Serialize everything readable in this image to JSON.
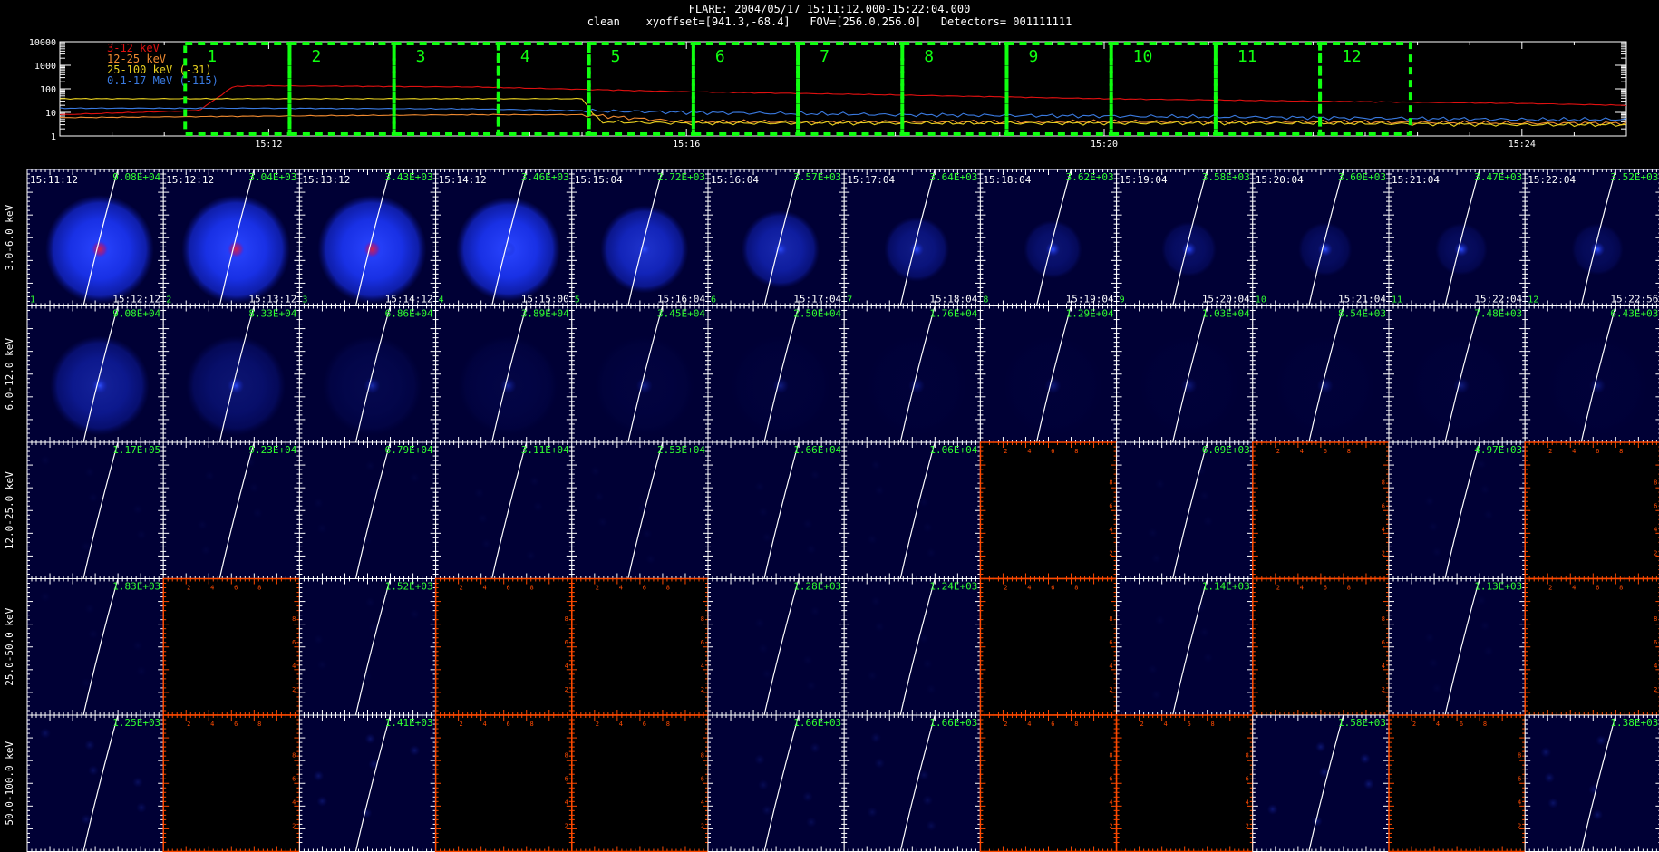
{
  "header": {
    "line1": "FLARE: 2004/05/17 15:11:12.000-15:22:04.000",
    "line2": "clean    xyoffset=[941.3,-68.4]   FOV=[256.0,256.0]   Detectors= 001111111"
  },
  "chart_data": [
    {
      "type": "line",
      "y_scale": "log",
      "ylim": [
        1,
        10000
      ],
      "y_ticks": [
        "10000",
        "1000",
        "100",
        "10",
        "1"
      ],
      "x_ticks": [
        "15:12",
        "15:16",
        "15:20",
        "15:24"
      ],
      "time_range": [
        "15:10",
        "15:25"
      ],
      "series": [
        {
          "name": "3-12 keV",
          "color": "#e01010",
          "times": [
            "15:10",
            "15:11:20",
            "15:11:40",
            "15:12",
            "15:14",
            "15:16",
            "15:18",
            "15:20",
            "15:22",
            "15:24",
            "15:25"
          ],
          "values": [
            8,
            12,
            130,
            135,
            120,
            75,
            55,
            38,
            30,
            24,
            20
          ]
        },
        {
          "name": "12-25 keV",
          "color": "#f08a30",
          "times": [
            "15:10",
            "15:12",
            "15:14",
            "15:15",
            "15:16",
            "15:18",
            "15:20",
            "15:22",
            "15:24",
            "15:25"
          ],
          "values": [
            6,
            7,
            8,
            8,
            4,
            4,
            4,
            4,
            3.5,
            3.5
          ]
        },
        {
          "name": "25-100 keV (-31)",
          "color": "#e8d020",
          "times": [
            "15:10",
            "15:12",
            "15:14",
            "15:15",
            "15:15:10",
            "15:16",
            "15:18",
            "15:20",
            "15:22",
            "15:24",
            "15:25"
          ],
          "values": [
            38,
            38,
            38,
            38,
            4,
            3.5,
            3.5,
            3.5,
            3.5,
            3,
            3
          ]
        },
        {
          "name": "0.1-17 MeV (-115)",
          "color": "#3a7ae0",
          "times": [
            "15:10",
            "15:12",
            "15:14",
            "15:16",
            "15:18",
            "15:20",
            "15:22",
            "15:24",
            "15:25"
          ],
          "values": [
            15,
            15,
            14,
            10,
            8,
            7,
            6,
            5,
            5
          ]
        }
      ],
      "annotations": [
        "1",
        "2",
        "3",
        "4",
        "5",
        "6",
        "7",
        "8",
        "9",
        "10",
        "11",
        "12"
      ],
      "interval_starts": [
        "15:11:12",
        "15:12:12",
        "15:13:12",
        "15:14:12",
        "15:15:04",
        "15:16:04",
        "15:17:04",
        "15:18:04",
        "15:19:04",
        "15:20:04",
        "15:21:04",
        "15:22:04"
      ],
      "interval_end": "15:22:56"
    },
    {
      "type": "heatmap",
      "rows": [
        "3.0-6.0 keV",
        "6.0-12.0 keV",
        "12.0-25.0 keV",
        "25.0-50.0 keV",
        "50.0-100.0 keV"
      ],
      "start_times": [
        "15:11:12",
        "15:12:12",
        "15:13:12",
        "15:14:12",
        "15:15:04",
        "15:16:04",
        "15:17:04",
        "15:18:04",
        "15:19:04",
        "15:20:04",
        "15:21:04",
        "15:22:04"
      ],
      "end_times": [
        "15:12:12",
        "15:13:12",
        "15:14:12",
        "15:15:00",
        "15:16:04",
        "15:17:04",
        "15:18:04",
        "15:19:04",
        "15:20:04",
        "15:21:04",
        "15:22:04",
        "15:22:56"
      ],
      "indices": [
        "1",
        "2",
        "3",
        "4",
        "5",
        "6",
        "7",
        "8",
        "9",
        "10",
        "11",
        "12"
      ],
      "axis_ticks": [
        "2",
        "4",
        "6",
        "8"
      ],
      "maxima": [
        [
          "9.08E+04",
          "3.04E+03",
          "3.43E+03",
          "3.46E+03",
          "2.72E+03",
          "3.57E+03",
          "3.64E+03",
          "3.62E+03",
          "3.58E+03",
          "3.60E+03",
          "3.47E+03",
          "3.52E+03"
        ],
        [
          "9.08E+04",
          "8.33E+04",
          "6.86E+04",
          "3.89E+04",
          "3.45E+04",
          "2.50E+04",
          "1.76E+04",
          "1.29E+04",
          "1.03E+04",
          "8.54E+03",
          "7.48E+03",
          "6.43E+03"
        ],
        [
          "1.17E+05",
          "9.23E+04",
          "6.79E+04",
          "3.11E+04",
          "2.53E+04",
          "1.66E+04",
          "1.06E+04",
          "",
          "6.09E+03",
          "",
          "4.97E+03",
          ""
        ],
        [
          "1.83E+03",
          "",
          "1.52E+03",
          "",
          "",
          "1.28E+03",
          "1.24E+03",
          "",
          "1.14E+03",
          "",
          "1.13E+03",
          ""
        ],
        [
          "1.25E+03",
          "",
          "1.41E+03",
          "",
          "",
          "1.66E+03",
          "1.66E+03",
          "",
          "",
          "1.58E+03",
          "",
          "1.38E+03"
        ]
      ],
      "source_strength": [
        [
          1.0,
          1.0,
          1.0,
          0.85,
          0.6,
          0.45,
          0.25,
          0.15,
          0.1,
          0.08,
          0.06,
          0.05
        ],
        [
          0.5,
          0.3,
          0.12,
          0.08,
          0.05,
          0.03,
          0.02,
          0.02,
          0.02,
          0.02,
          0.02,
          0.02
        ],
        [
          0.05,
          0.05,
          0.05,
          0.05,
          0.05,
          0.05,
          0.05,
          0,
          0.05,
          0,
          0.05,
          0
        ],
        [
          0.05,
          0,
          0.05,
          0,
          0,
          0.05,
          0.05,
          0,
          0.05,
          0,
          0.05,
          0
        ],
        [
          0.2,
          0,
          0.25,
          0,
          0,
          0.15,
          0.15,
          0,
          0,
          0.3,
          0,
          0.25
        ]
      ],
      "colors": {
        "panel_bg": "#000035",
        "empty_bg": "#000000",
        "empty_axis": "#ff4a00",
        "label_text": "#30ff30",
        "time_text": "#ffffff",
        "limb": "#ffffff",
        "disk": "#1a33ff",
        "core": "#c02060"
      }
    }
  ]
}
